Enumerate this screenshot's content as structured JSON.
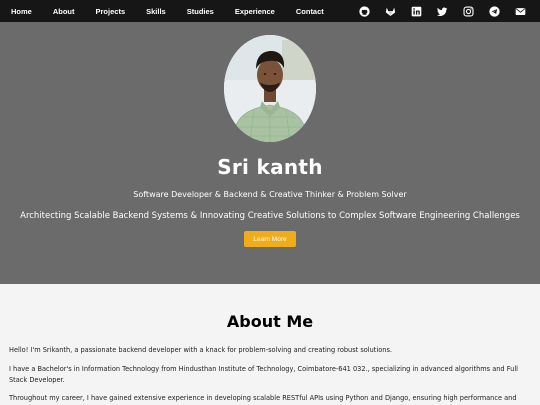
{
  "nav": {
    "links": [
      "Home",
      "About",
      "Projects",
      "Skills",
      "Studies",
      "Experience",
      "Contact"
    ],
    "icons": [
      "github-icon",
      "gitlab-icon",
      "linkedin-icon",
      "twitter-icon",
      "instagram-icon",
      "telegram-icon",
      "email-icon"
    ]
  },
  "hero": {
    "name": "Sri kanth",
    "roles": "Software Developer & Backend & Creative Thinker & Problem Solver",
    "tagline": "Architecting Scalable Backend Systems & Innovating Creative Solutions to Complex Software Engineering Challenges",
    "button_label": "Learn More",
    "accent_color": "#f0ad1b",
    "background_color": "#6b6b6b"
  },
  "about": {
    "title": "About Me",
    "paragraphs": [
      "Hello! I'm Srikanth, a passionate backend developer with a knack for problem-solving and creating robust solutions.",
      "I have a Bachelor's in Information Technology from Hindusthan Institute of Technology, Coimbatore-641 032., specializing in advanced algorithms and Full Stack Developer.",
      "Throughout my career, I have gained extensive experience in developing scalable RESTful APIs using Python and Django, ensuring high performance and"
    ]
  }
}
